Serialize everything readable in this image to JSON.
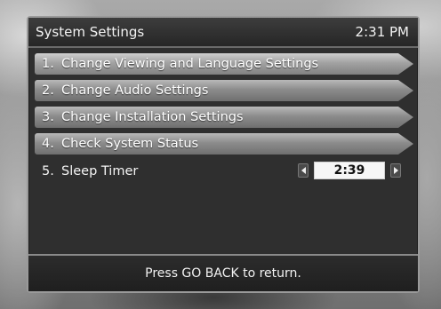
{
  "window": {
    "title": "System Settings",
    "clock": "2:31 PM"
  },
  "menu": {
    "items": [
      {
        "num": "1.",
        "label": "Change Viewing and Language Settings"
      },
      {
        "num": "2.",
        "label": "Change Audio Settings"
      },
      {
        "num": "3.",
        "label": "Change Installation Settings"
      },
      {
        "num": "4.",
        "label": "Check System Status"
      }
    ],
    "sleep_timer": {
      "num": "5.",
      "label": "Sleep Timer",
      "value": "2:39"
    }
  },
  "footer": {
    "hint": "Press GO BACK to return."
  },
  "icons": {
    "decrease": "left-arrow-icon",
    "increase": "right-arrow-icon"
  }
}
